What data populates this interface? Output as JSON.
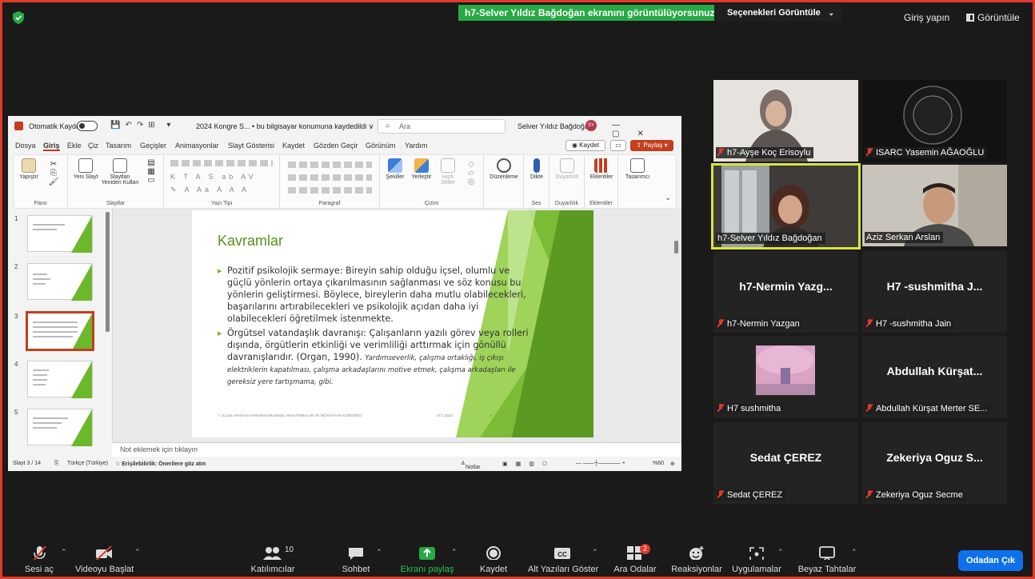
{
  "zoom": {
    "share_banner": "h7-Selver Yıldız Bağdoğan ekranını görüntülüyorsunuz",
    "options_label": "Seçenekleri Görüntüle",
    "login_label": "Giriş yapın",
    "view_label": "Görüntüle",
    "participants": [
      {
        "name": "h7-Ayşe Koç Erisoylu",
        "video": true
      },
      {
        "name": "ISARC Yasemin AĞAOĞLU",
        "video": true
      },
      {
        "name": "h7-Selver Yıldız Bağdoğan",
        "video": true,
        "active": true
      },
      {
        "name": "Aziz Serkan Arslan",
        "video": true
      },
      {
        "name": "h7-Nermin Yazgan",
        "display": "h7-Nermin Yazg..."
      },
      {
        "name": "H7 -sushmitha Jain",
        "display": "H7 -sushmitha J..."
      },
      {
        "name": "H7 sushmitha",
        "video": true
      },
      {
        "name": "Abdullah Kürşat Merter SE...",
        "display": "Abdullah Kürşat..."
      },
      {
        "name": "Sedat ÇEREZ",
        "display": "Sedat ÇEREZ"
      },
      {
        "name": "Zekeriya Oguz Secme",
        "display": "Zekeriya Oguz S..."
      }
    ],
    "toolbar": {
      "audio": "Sesi aç",
      "video": "Videoyu Başlat",
      "participants": "Katılımcılar",
      "participants_count": "10",
      "chat": "Sohbet",
      "share": "Ekranı paylaş",
      "record": "Kaydet",
      "captions": "Alt Yazıları Göster",
      "breakout": "Ara Odalar",
      "breakout_badge": "2",
      "reactions": "Reaksiyonlar",
      "apps": "Uygulamalar",
      "whiteboard": "Beyaz Tahtalar",
      "leave": "Odadan Çık"
    },
    "colors": {
      "share_green": "#27a944",
      "leave_blue": "#0e71eb",
      "active_border": "#d8e63a",
      "mute_red": "#e0392b"
    }
  },
  "ppt": {
    "autosave": "Otomatik Kaydet",
    "doc_name": "2024 Kongre S... • bu bilgisayar konumuna kaydedildi ∨",
    "search": "Ara",
    "user": "Selver Yıldız Bağdoğan",
    "user_initials": "SY",
    "menu": [
      "Dosya",
      "Giriş",
      "Ekle",
      "Çiz",
      "Tasarım",
      "Geçişler",
      "Animasyonlar",
      "Slayt Gösterisi",
      "Kaydet",
      "Gözden Geçir",
      "Görünüm",
      "Yardım"
    ],
    "save_btn": "Kaydet",
    "share_btn": "Paylaş",
    "ribbon": {
      "paste": "Yapıştır",
      "new_slide": "Yeni Slayt",
      "reuse": "Slaytları Yeniden Kullan",
      "clipboard_group": "Pano",
      "slides_group": "Slaytlar",
      "font_group": "Yazı Tipi",
      "paragraph_group": "Paragraf",
      "shapes": "Şekiller",
      "arrange": "Yerleştir",
      "quick_styles": "Hızlı Stiller",
      "drawing_group": "Çizim",
      "editing": "Düzenleme",
      "dictate": "Dikte",
      "voice_group": "Ses",
      "sensitivity": "Duyarlılık",
      "sensitivity_group": "Duyarlılık",
      "addins": "Eklentiler",
      "addins_group": "Eklentiler",
      "designer": "Tasarımcı"
    },
    "slide": {
      "title": "Kavramlar",
      "bullet1": "Pozitif psikolojik sermaye: Bireyin sahip olduğu içsel, olumlu ve güçlü yönlerin ortaya çıkarılmasının sağlanması ve söz konusu bu yönlerin geliştirmesi. Böylece, bireylerin daha mutlu olabilecekleri, başarılarını artırabilecekleri ve psikolojik açıdan daha iyi olabilecekleri öğretilmek istenmekte.",
      "bullet2": "Örgütsel vatandaşlık davranışı: Çalışanların yazılı görev veya rolleri dışında, örgütlerin etkinliği ve verimliliği arttırmak için gönüllü davranışlarıdır. (Organ, 1990).",
      "bullet2_italic": "Yardımseverlik, çalışma ortaklığı, iş çıkışı elektriklerin kapatılması, çalışma arkadaşlarını motive etmek, çalışma arkadaşları ile gereksiz yere tartışmama, gibi.",
      "footer": "7. ULUSLARARASI KARAMAN BİLİMSEL ARAŞTIRMALAR VE İNOVASYON KONGRESİ",
      "date": "27.1.2024",
      "page": "3"
    },
    "thumb_numbers": [
      "1",
      "2",
      "3",
      "4",
      "5"
    ],
    "notes_placeholder": "Not eklemek için tıklayın",
    "status": {
      "slide": "Slayt 3 / 14",
      "language": "Türkçe (Türkiye)",
      "accessibility": "Erişilebilirlik: Önerilere göz atın",
      "notes": "Notlar",
      "zoom": "%60"
    }
  }
}
